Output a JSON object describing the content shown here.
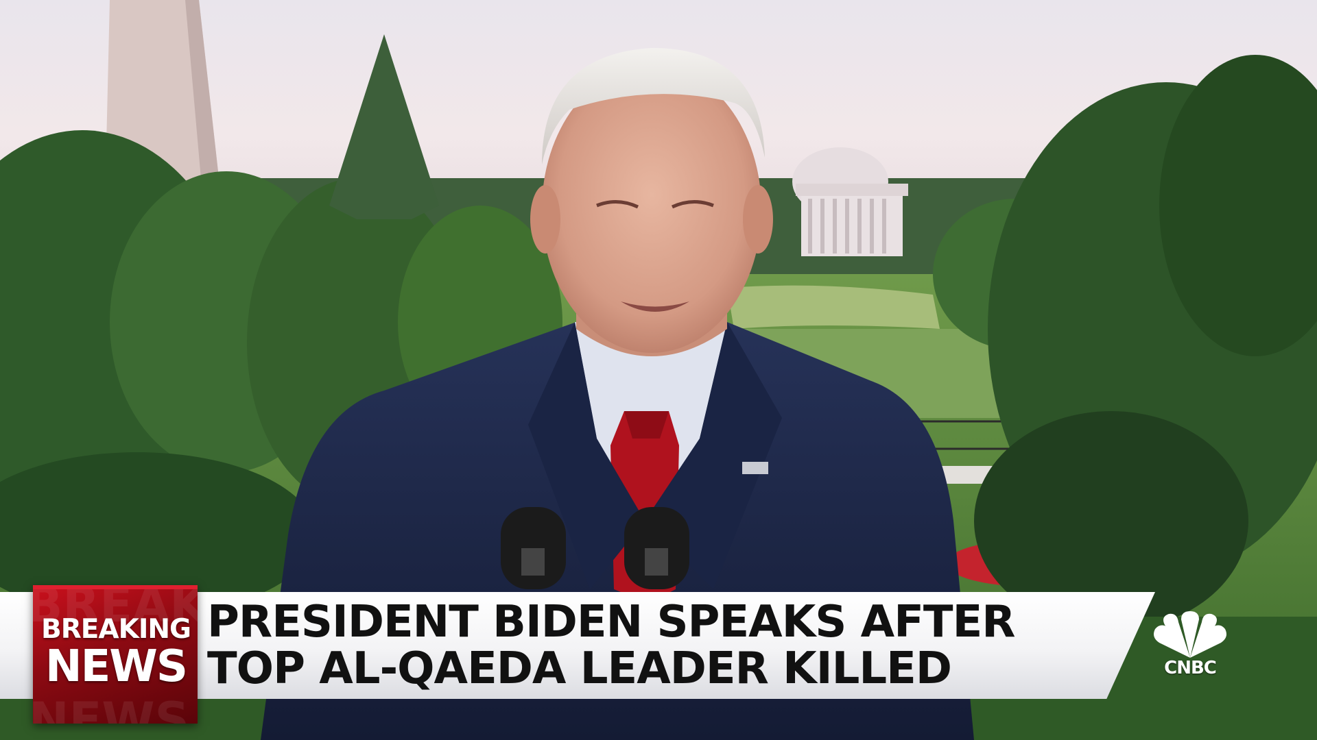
{
  "broadcast": {
    "badge": {
      "line1": "BREAKING",
      "line2": "NEWS"
    },
    "headline": {
      "line1": "PRESIDENT BIDEN SPEAKS AFTER",
      "line2": "TOP AL-QAEDA LEADER KILLED"
    },
    "network": {
      "name": "CNBC",
      "icon": "peacock-icon"
    }
  },
  "colors": {
    "badge_red": "#c8101c",
    "headline_text": "#111111",
    "suit_navy": "#1d2747",
    "tie_red": "#b0121e"
  }
}
